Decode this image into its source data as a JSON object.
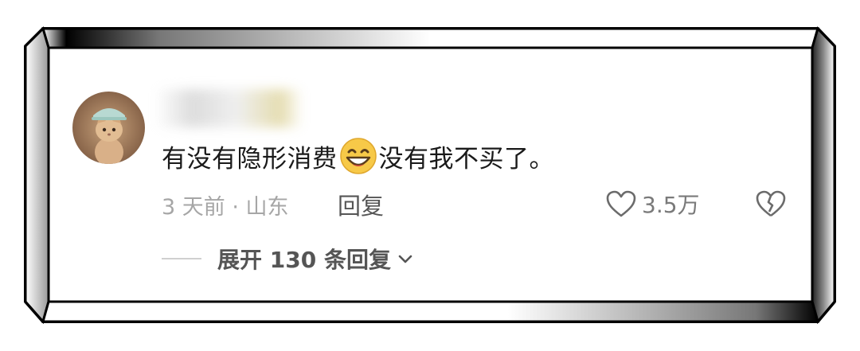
{
  "comment": {
    "text_before": "有没有隐形消费",
    "emoji": "grinning-face-emoji",
    "text_after": "没有我不买了。"
  },
  "meta": {
    "time_location": "3 天前 · 山东",
    "reply_label": "回复"
  },
  "likes": {
    "count": "3.5万"
  },
  "expand": {
    "label": "展开 130 条回复"
  },
  "colors": {
    "text": "#1a1a1a",
    "meta": "#a6a6a6",
    "action": "#555555",
    "emoji_face": "#f7c948"
  }
}
